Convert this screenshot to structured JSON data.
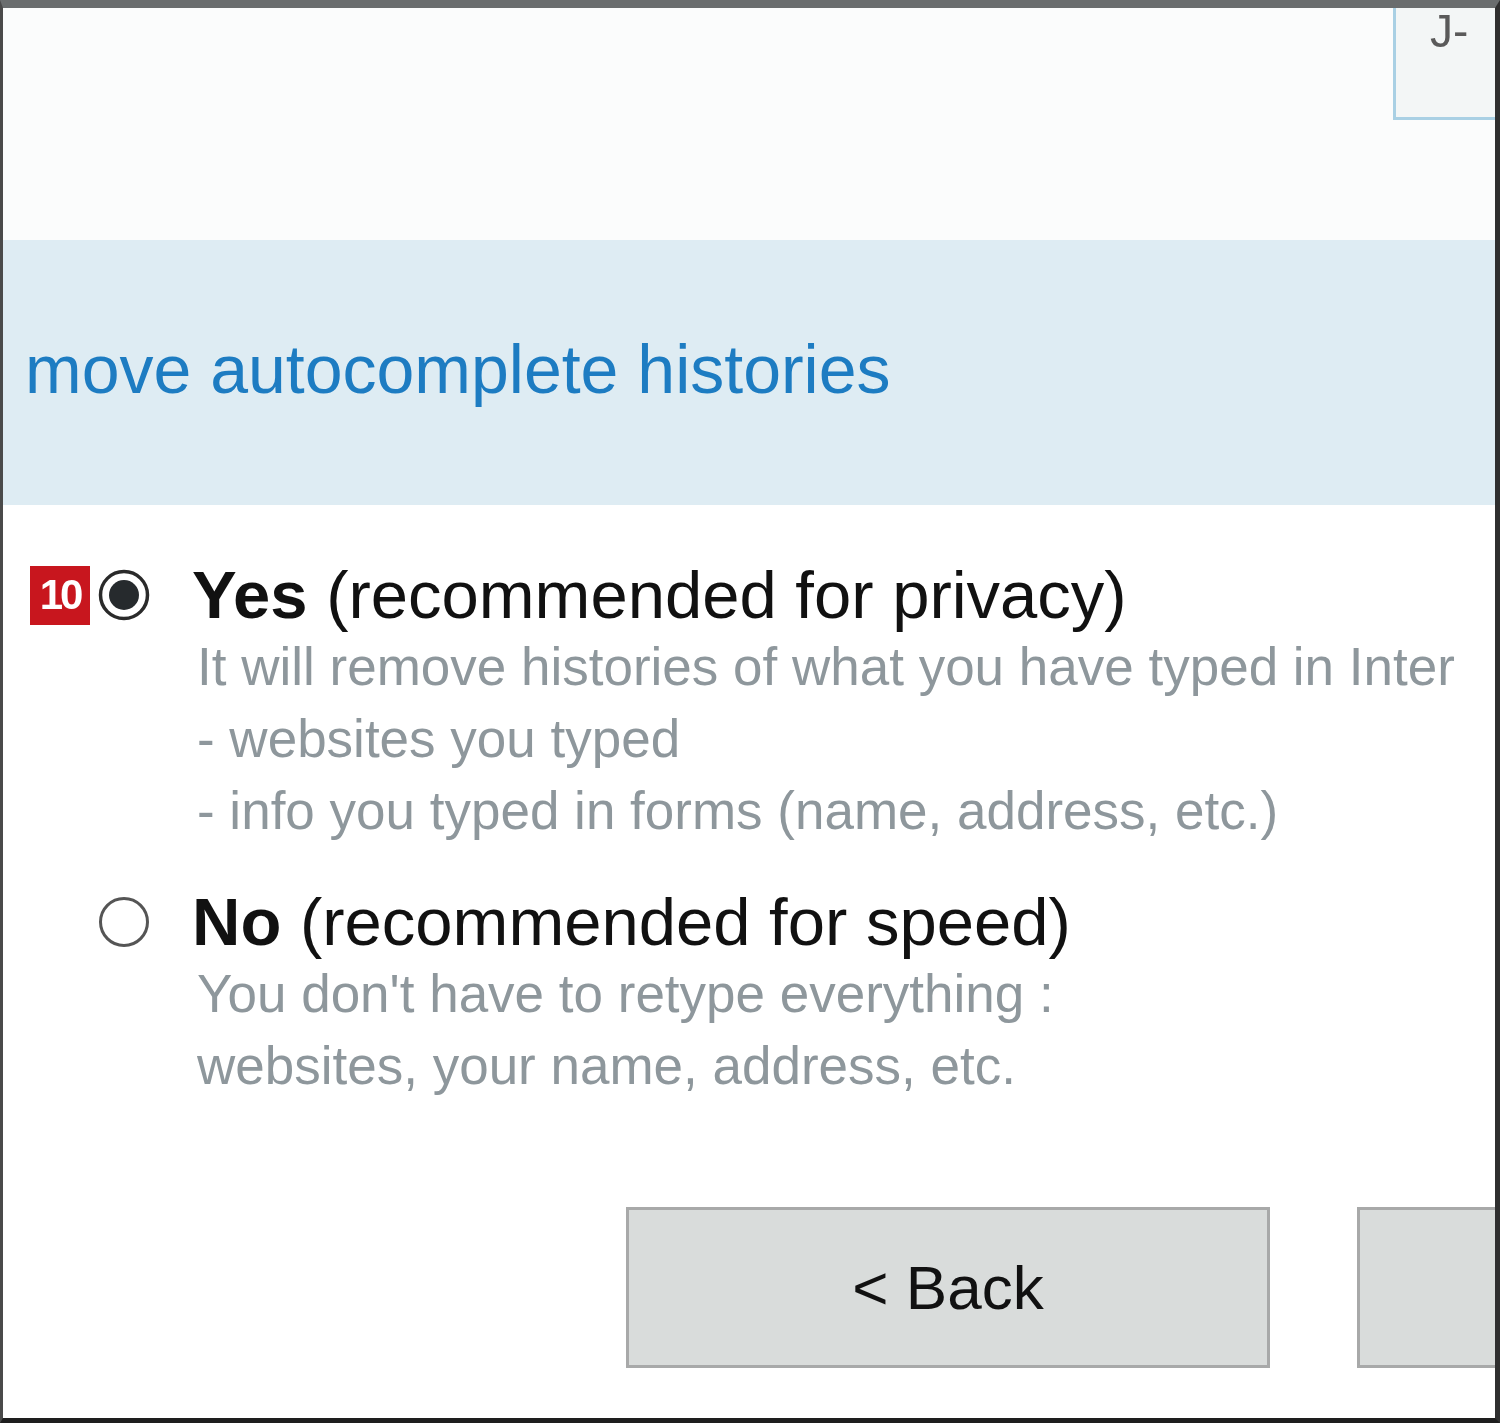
{
  "corner_button": {
    "label": "J-"
  },
  "banner": {
    "title": "move autocomplete histories"
  },
  "options": [
    {
      "badge": "10",
      "label": "**Yes** (recommended for privacy)",
      "selected": true,
      "description": [
        "It will remove histories of what you have typed in Inter",
        "- websites you typed",
        "- info you typed in forms (name, address, etc.)"
      ]
    },
    {
      "label": "**No** (recommended for speed)",
      "selected": false,
      "description": [
        "You don't have to retype everything :",
        "websites, your name, address, etc."
      ]
    }
  ],
  "buttons": [
    {
      "kind": "labeled",
      "label": "< Back"
    },
    {
      "kind": "cut_off"
    }
  ]
}
